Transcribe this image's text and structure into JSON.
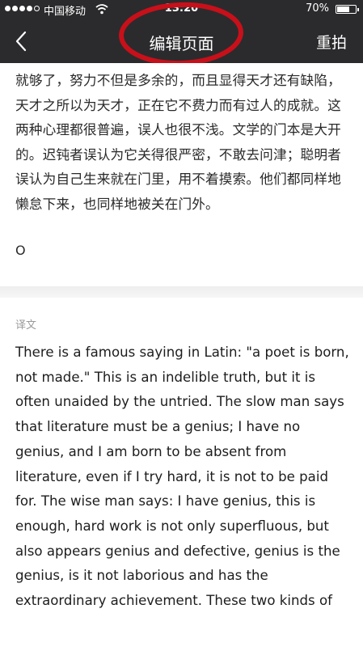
{
  "status_bar": {
    "carrier": "中国移动",
    "time": "13:20",
    "battery_percent": "70%",
    "battery_level": 0.7
  },
  "nav": {
    "title": "编辑页面",
    "right_button": "重拍",
    "highlight_color": "#c8101a"
  },
  "original": {
    "text": "就够了，努力不但是多余的，而且显得天才还有缺陷，天才之所以为天才，正在它不费力而有过人的成就。这两种心理都很普遍，误人也很不浅。文学的门本是大开的。迟钝者误认为它关得很严密，不敢去问津；聪明者误认为自己生来就在门里，用不着摸索。他们都同样地懒怠下来，也同样地被关在门外。",
    "tail": "O"
  },
  "translation": {
    "label": "译文",
    "text": "There is a famous saying in Latin: \"a poet is born, not made.\" This is an indelible truth, but it is often unaided by the untried. The slow man says that literature must be a genius; I have no genius, and I am born to be absent from literature, even if I try hard, it is not to be paid for. The wise man says: I have genius, this is enough, hard work is not only superfluous, but also appears genius and defective, genius is the genius, is it not laborious and has the extraordinary achievement. These two kinds of"
  }
}
